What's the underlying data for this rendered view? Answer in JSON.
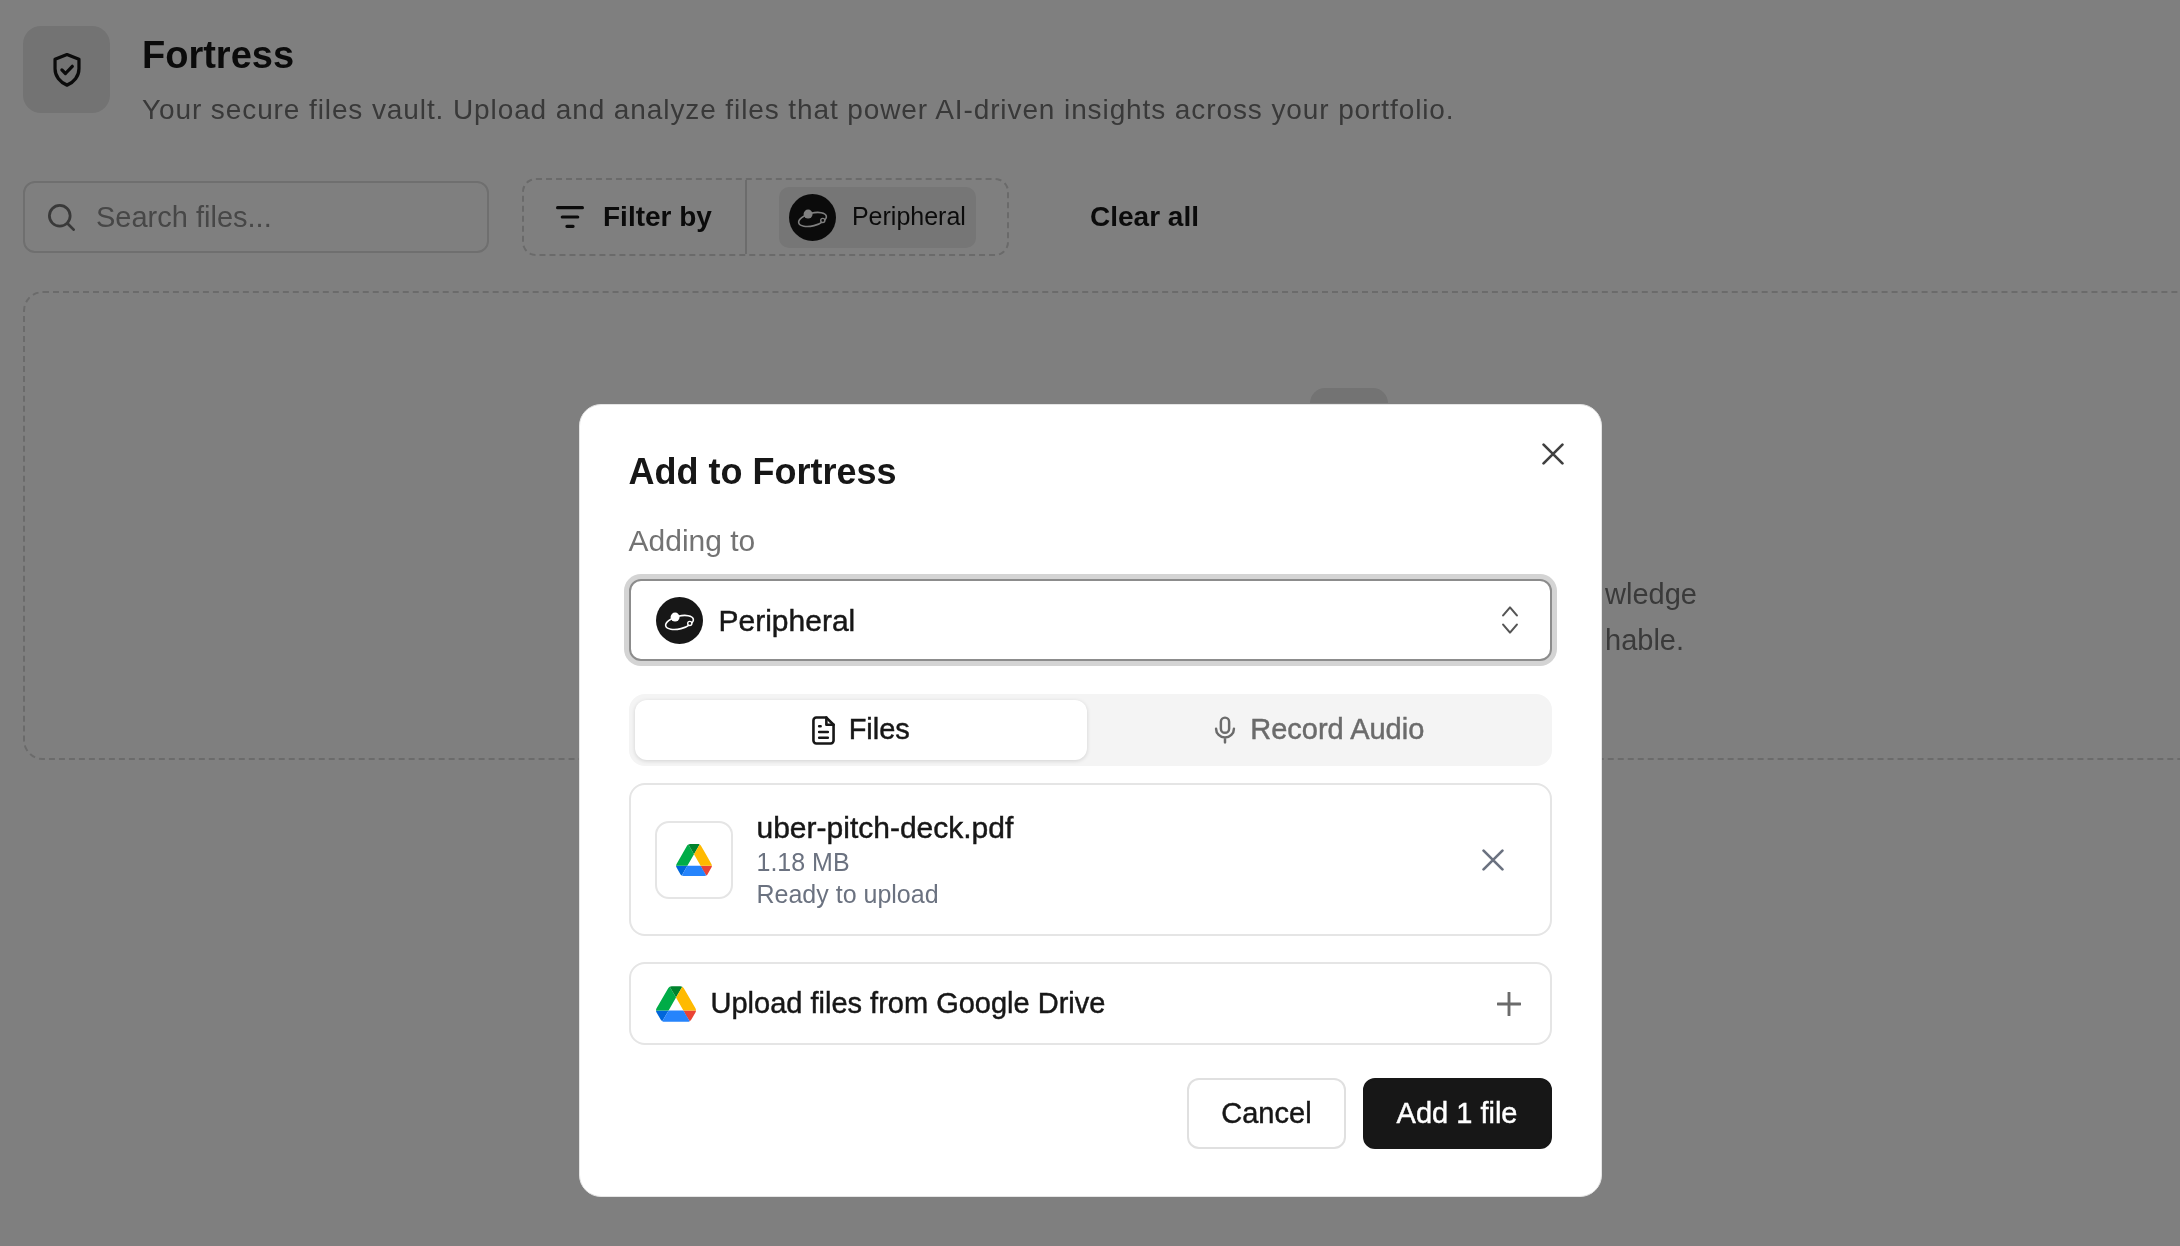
{
  "header": {
    "title": "Fortress",
    "subtitle": "Your secure files vault. Upload and analyze files that power AI-driven insights across your portfolio."
  },
  "toolbar": {
    "search": {
      "placeholder": "Search files..."
    },
    "filter_button": "Filter by",
    "active_filters": [
      {
        "label": "Peripheral"
      }
    ],
    "clear_button": "Clear all"
  },
  "dropzone": {
    "text_lines": [
      "wledge",
      "hable."
    ]
  },
  "dialog": {
    "title": "Add to Fortress",
    "target_label": "Adding to",
    "target_select": {
      "value": "Peripheral"
    },
    "tabs": [
      {
        "label": "Files",
        "kind": "file",
        "selected": true
      },
      {
        "label": "Record Audio",
        "kind": "audio",
        "selected": false
      }
    ],
    "files": [
      {
        "name": "uber-pitch-deck.pdf",
        "size": "1.18 MB",
        "status": "Ready to upload"
      }
    ],
    "drive_button": "Upload files from Google Drive",
    "buttons": [
      {
        "label": "Cancel",
        "kind": "secondary"
      },
      {
        "label": "Add 1 file",
        "kind": "primary"
      }
    ]
  }
}
